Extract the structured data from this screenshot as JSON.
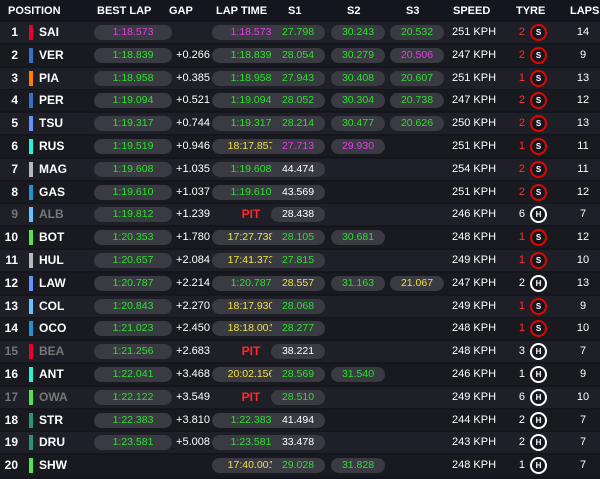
{
  "headers": {
    "position": "POSITION",
    "best_lap": "BEST LAP",
    "gap": "GAP",
    "lap_time": "LAP TIME",
    "s1": "S1",
    "s2": "S2",
    "s3": "S3",
    "speed": "SPEED",
    "tyre": "TYRE",
    "laps": "LAPS"
  },
  "colors": {
    "personal_best": "#2be02b",
    "overall_best": "#e040e0",
    "lap_in_progress": "#f0e040",
    "pit": "#ff2a2a",
    "soft_tyre": "#e10600",
    "hard_tyre": "#ffffff"
  },
  "rows": [
    {
      "pos": "1",
      "code": "SAI",
      "team": "#e8002d",
      "best": "1:18.573",
      "best_c": "p",
      "gap": "",
      "lap": "1:18.573",
      "lap_c": "p",
      "s1": "27.798",
      "s1_c": "g",
      "s2": "30.243",
      "s2_c": "g",
      "s3": "20.532",
      "s3_c": "g",
      "speed": "251 KPH",
      "tn": "2",
      "tn_red": true,
      "tyre": "S",
      "laps": "14",
      "dim": false
    },
    {
      "pos": "2",
      "code": "VER",
      "team": "#3671c6",
      "best": "1:18.839",
      "best_c": "g",
      "gap": "+0.266",
      "lap": "1:18.839",
      "lap_c": "g",
      "s1": "28.054",
      "s1_c": "g",
      "s2": "30.279",
      "s2_c": "g",
      "s3": "20.506",
      "s3_c": "p",
      "speed": "247 KPH",
      "tn": "2",
      "tn_red": true,
      "tyre": "S",
      "laps": "9",
      "dim": false
    },
    {
      "pos": "3",
      "code": "PIA",
      "team": "#ff8000",
      "best": "1:18.958",
      "best_c": "g",
      "gap": "+0.385",
      "lap": "1:18.958",
      "lap_c": "g",
      "s1": "27.943",
      "s1_c": "g",
      "s2": "30.408",
      "s2_c": "g",
      "s3": "20.607",
      "s3_c": "g",
      "speed": "251 KPH",
      "tn": "1",
      "tn_red": true,
      "tyre": "S",
      "laps": "13",
      "dim": false
    },
    {
      "pos": "4",
      "code": "PER",
      "team": "#3671c6",
      "best": "1:19.094",
      "best_c": "g",
      "gap": "+0.521",
      "lap": "1:19.094",
      "lap_c": "g",
      "s1": "28.052",
      "s1_c": "g",
      "s2": "30.304",
      "s2_c": "g",
      "s3": "20.738",
      "s3_c": "g",
      "speed": "247 KPH",
      "tn": "2",
      "tn_red": true,
      "tyre": "S",
      "laps": "12",
      "dim": false
    },
    {
      "pos": "5",
      "code": "TSU",
      "team": "#6692ff",
      "best": "1:19.317",
      "best_c": "g",
      "gap": "+0.744",
      "lap": "1:19.317",
      "lap_c": "g",
      "s1": "28.214",
      "s1_c": "g",
      "s2": "30.477",
      "s2_c": "g",
      "s3": "20.626",
      "s3_c": "g",
      "speed": "250 KPH",
      "tn": "2",
      "tn_red": true,
      "tyre": "S",
      "laps": "13",
      "dim": false
    },
    {
      "pos": "6",
      "code": "RUS",
      "team": "#27f4d2",
      "best": "1:19.519",
      "best_c": "g",
      "gap": "+0.946",
      "lap": "18:17.857",
      "lap_c": "y",
      "s1": "27.713",
      "s1_c": "p",
      "s2": "29.930",
      "s2_c": "p",
      "s3": "",
      "s3_c": "w",
      "speed": "251 KPH",
      "tn": "1",
      "tn_red": true,
      "tyre": "S",
      "laps": "11",
      "dim": false
    },
    {
      "pos": "7",
      "code": "MAG",
      "team": "#b6babd",
      "best": "1:19.608",
      "best_c": "g",
      "gap": "+1.035",
      "lap": "1:19.608",
      "lap_c": "g",
      "s1": "44.474",
      "s1_c": "w",
      "s2": "",
      "s2_c": "w",
      "s3": "",
      "s3_c": "w",
      "speed": "254 KPH",
      "tn": "2",
      "tn_red": true,
      "tyre": "S",
      "laps": "11",
      "dim": false
    },
    {
      "pos": "8",
      "code": "GAS",
      "team": "#2293d1",
      "best": "1:19.610",
      "best_c": "g",
      "gap": "+1.037",
      "lap": "1:19.610",
      "lap_c": "g",
      "s1": "43.569",
      "s1_c": "w",
      "s2": "",
      "s2_c": "w",
      "s3": "",
      "s3_c": "w",
      "speed": "251 KPH",
      "tn": "2",
      "tn_red": true,
      "tyre": "S",
      "laps": "12",
      "dim": false
    },
    {
      "pos": "9",
      "code": "ALB",
      "team": "#64c4ff",
      "best": "1:19.812",
      "best_c": "g",
      "gap": "+1.239",
      "lap": "PIT",
      "lap_c": "pit",
      "s1": "28.438",
      "s1_c": "w",
      "s2": "",
      "s2_c": "w",
      "s3": "",
      "s3_c": "w",
      "speed": "246 KPH",
      "tn": "6",
      "tn_red": false,
      "tyre": "H",
      "laps": "7",
      "dim": true
    },
    {
      "pos": "10",
      "code": "BOT",
      "team": "#52e252",
      "best": "1:20.353",
      "best_c": "g",
      "gap": "+1.780",
      "lap": "17:27.738",
      "lap_c": "y",
      "s1": "28.105",
      "s1_c": "g",
      "s2": "30.681",
      "s2_c": "g",
      "s3": "",
      "s3_c": "w",
      "speed": "248 KPH",
      "tn": "1",
      "tn_red": true,
      "tyre": "S",
      "laps": "12",
      "dim": false
    },
    {
      "pos": "11",
      "code": "HUL",
      "team": "#b6babd",
      "best": "1:20.657",
      "best_c": "g",
      "gap": "+2.084",
      "lap": "17:41.373",
      "lap_c": "y",
      "s1": "27.815",
      "s1_c": "g",
      "s2": "",
      "s2_c": "w",
      "s3": "",
      "s3_c": "w",
      "speed": "249 KPH",
      "tn": "1",
      "tn_red": true,
      "tyre": "S",
      "laps": "10",
      "dim": false
    },
    {
      "pos": "12",
      "code": "LAW",
      "team": "#6692ff",
      "best": "1:20.787",
      "best_c": "g",
      "gap": "+2.214",
      "lap": "1:20.787",
      "lap_c": "g",
      "s1": "28.557",
      "s1_c": "y",
      "s2": "31.163",
      "s2_c": "g",
      "s3": "21.067",
      "s3_c": "y",
      "speed": "247 KPH",
      "tn": "2",
      "tn_red": false,
      "tyre": "H",
      "laps": "13",
      "dim": false
    },
    {
      "pos": "13",
      "code": "COL",
      "team": "#64c4ff",
      "best": "1:20.843",
      "best_c": "g",
      "gap": "+2.270",
      "lap": "18:17.930",
      "lap_c": "y",
      "s1": "28.068",
      "s1_c": "g",
      "s2": "",
      "s2_c": "w",
      "s3": "",
      "s3_c": "w",
      "speed": "249 KPH",
      "tn": "1",
      "tn_red": true,
      "tyre": "S",
      "laps": "9",
      "dim": false
    },
    {
      "pos": "14",
      "code": "OCO",
      "team": "#2293d1",
      "best": "1:21.023",
      "best_c": "g",
      "gap": "+2.450",
      "lap": "18:18.001",
      "lap_c": "y",
      "s1": "28.277",
      "s1_c": "g",
      "s2": "",
      "s2_c": "w",
      "s3": "",
      "s3_c": "w",
      "speed": "248 KPH",
      "tn": "1",
      "tn_red": true,
      "tyre": "S",
      "laps": "10",
      "dim": false
    },
    {
      "pos": "15",
      "code": "BEA",
      "team": "#e8002d",
      "best": "1:21.256",
      "best_c": "g",
      "gap": "+2.683",
      "lap": "PIT",
      "lap_c": "pit",
      "s1": "38.221",
      "s1_c": "w",
      "s2": "",
      "s2_c": "w",
      "s3": "",
      "s3_c": "w",
      "speed": "248 KPH",
      "tn": "3",
      "tn_red": false,
      "tyre": "H",
      "laps": "7",
      "dim": true
    },
    {
      "pos": "16",
      "code": "ANT",
      "team": "#27f4d2",
      "best": "1:22.041",
      "best_c": "g",
      "gap": "+3.468",
      "lap": "20:02.156",
      "lap_c": "y",
      "s1": "28.569",
      "s1_c": "g",
      "s2": "31.540",
      "s2_c": "g",
      "s3": "",
      "s3_c": "w",
      "speed": "246 KPH",
      "tn": "1",
      "tn_red": false,
      "tyre": "H",
      "laps": "9",
      "dim": false
    },
    {
      "pos": "17",
      "code": "OWA",
      "team": "#52e252",
      "best": "1:22.122",
      "best_c": "g",
      "gap": "+3.549",
      "lap": "PIT",
      "lap_c": "pit",
      "s1": "28.510",
      "s1_c": "g",
      "s2": "",
      "s2_c": "w",
      "s3": "",
      "s3_c": "w",
      "speed": "249 KPH",
      "tn": "6",
      "tn_red": false,
      "tyre": "H",
      "laps": "10",
      "dim": true
    },
    {
      "pos": "18",
      "code": "STR",
      "team": "#229971",
      "best": "1:22.383",
      "best_c": "g",
      "gap": "+3.810",
      "lap": "1:22.383",
      "lap_c": "g",
      "s1": "41.494",
      "s1_c": "w",
      "s2": "",
      "s2_c": "w",
      "s3": "",
      "s3_c": "w",
      "speed": "244 KPH",
      "tn": "2",
      "tn_red": false,
      "tyre": "H",
      "laps": "7",
      "dim": false
    },
    {
      "pos": "19",
      "code": "DRU",
      "team": "#229971",
      "best": "1:23.581",
      "best_c": "g",
      "gap": "+5.008",
      "lap": "1:23.581",
      "lap_c": "g",
      "s1": "33.478",
      "s1_c": "w",
      "s2": "",
      "s2_c": "w",
      "s3": "",
      "s3_c": "w",
      "speed": "243 KPH",
      "tn": "2",
      "tn_red": false,
      "tyre": "H",
      "laps": "7",
      "dim": false
    },
    {
      "pos": "20",
      "code": "SHW",
      "team": "#52e252",
      "best": "",
      "best_c": "w",
      "gap": "",
      "lap": "17:40.001",
      "lap_c": "y",
      "s1": "29.028",
      "s1_c": "g",
      "s2": "31.828",
      "s2_c": "g",
      "s3": "",
      "s3_c": "w",
      "speed": "248 KPH",
      "tn": "1",
      "tn_red": false,
      "tyre": "H",
      "laps": "7",
      "dim": false
    }
  ]
}
